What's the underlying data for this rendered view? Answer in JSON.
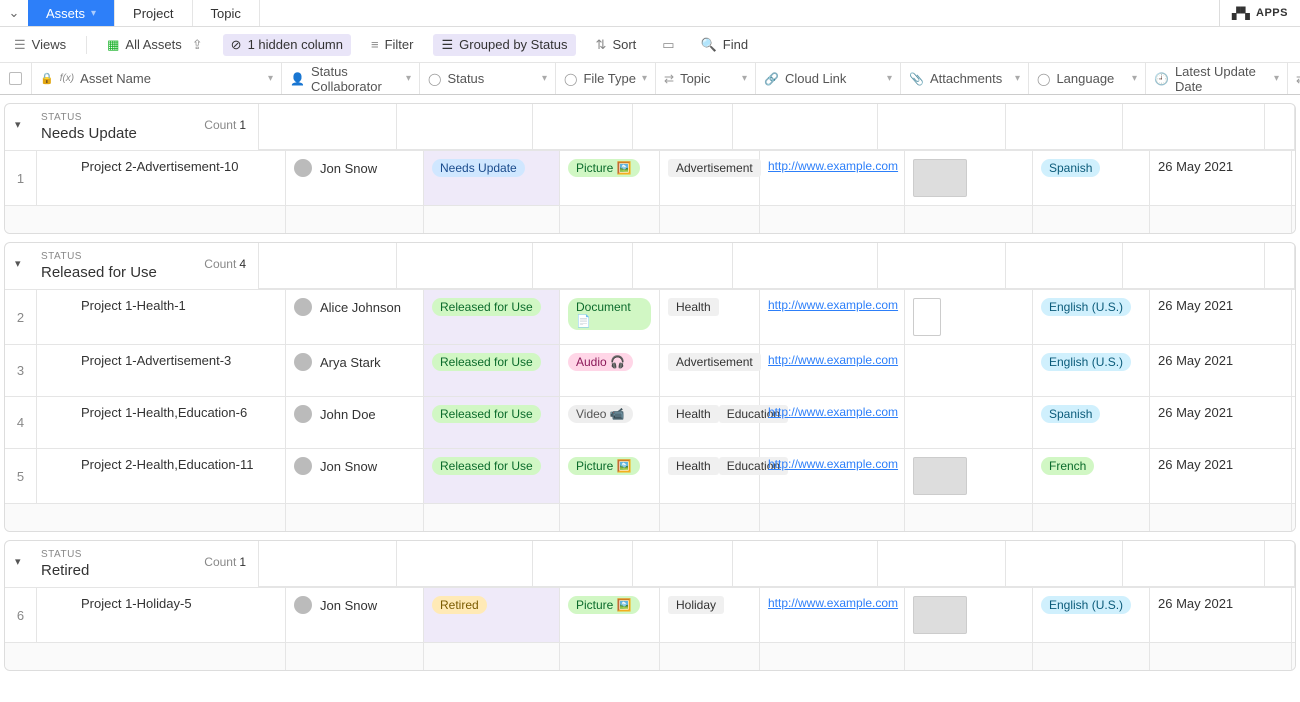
{
  "tabs": {
    "assets": "Assets",
    "project": "Project",
    "topic": "Topic"
  },
  "apps_label": "APPS",
  "toolbar": {
    "views": "Views",
    "all_assets": "All Assets",
    "hidden": "1 hidden column",
    "filter": "Filter",
    "grouped": "Grouped by Status",
    "sort": "Sort",
    "find": "Find"
  },
  "columns": {
    "name": "Asset Name",
    "collab": "Status Collaborator",
    "status": "Status",
    "filetype": "File Type",
    "topic": "Topic",
    "cloud": "Cloud Link",
    "attach": "Attachments",
    "lang": "Language",
    "date": "Latest Update Date"
  },
  "group_label": "STATUS",
  "count_label": "Count",
  "groups": [
    {
      "status": "Needs Update",
      "count": "1",
      "rows": [
        {
          "num": "1",
          "name": "Project 2-Advertisement-10",
          "collab": "Jon Snow",
          "status": "Needs Update",
          "status_cls": "blue",
          "filetype": "Picture 🖼️",
          "file_cls": "green",
          "topics": [
            "Advertisement"
          ],
          "cloud": "http://www.example.com",
          "thumb": "img",
          "lang": "Spanish",
          "lang_cls": "cyan",
          "date": "26 May 2021"
        }
      ]
    },
    {
      "status": "Released for Use",
      "count": "4",
      "rows": [
        {
          "num": "2",
          "name": "Project 1-Health-1",
          "collab": "Alice Johnson",
          "status": "Released for Use",
          "status_cls": "green",
          "filetype": "Document 📄",
          "file_cls": "green",
          "topics": [
            "Health"
          ],
          "cloud": "http://www.example.com",
          "thumb": "doc",
          "lang": "English (U.S.)",
          "lang_cls": "cyan",
          "date": "26 May 2021"
        },
        {
          "num": "3",
          "name": "Project 1-Advertisement-3",
          "collab": "Arya Stark",
          "status": "Released for Use",
          "status_cls": "green",
          "filetype": "Audio 🎧",
          "file_cls": "pink",
          "topics": [
            "Advertisement"
          ],
          "cloud": "http://www.example.com",
          "thumb": "",
          "lang": "English (U.S.)",
          "lang_cls": "cyan",
          "date": "26 May 2021"
        },
        {
          "num": "4",
          "name": "Project 1-Health,Education-6",
          "collab": "John Doe",
          "status": "Released for Use",
          "status_cls": "green",
          "filetype": "Video 📹",
          "file_cls": "gray",
          "topics": [
            "Health",
            "Education"
          ],
          "cloud": "http://www.example.com",
          "thumb": "",
          "lang": "Spanish",
          "lang_cls": "cyan",
          "date": "26 May 2021"
        },
        {
          "num": "5",
          "name": "Project 2-Health,Education-11",
          "collab": "Jon Snow",
          "status": "Released for Use",
          "status_cls": "green",
          "filetype": "Picture 🖼️",
          "file_cls": "green",
          "topics": [
            "Health",
            "Education"
          ],
          "cloud": "http://www.example.com",
          "thumb": "img",
          "lang": "French",
          "lang_cls": "green",
          "date": "26 May 2021"
        }
      ]
    },
    {
      "status": "Retired",
      "count": "1",
      "rows": [
        {
          "num": "6",
          "name": "Project 1-Holiday-5",
          "collab": "Jon Snow",
          "status": "Retired",
          "status_cls": "yellow",
          "filetype": "Picture 🖼️",
          "file_cls": "green",
          "topics": [
            "Holiday"
          ],
          "cloud": "http://www.example.com",
          "thumb": "img",
          "lang": "English (U.S.)",
          "lang_cls": "cyan",
          "date": "26 May 2021"
        }
      ]
    }
  ]
}
